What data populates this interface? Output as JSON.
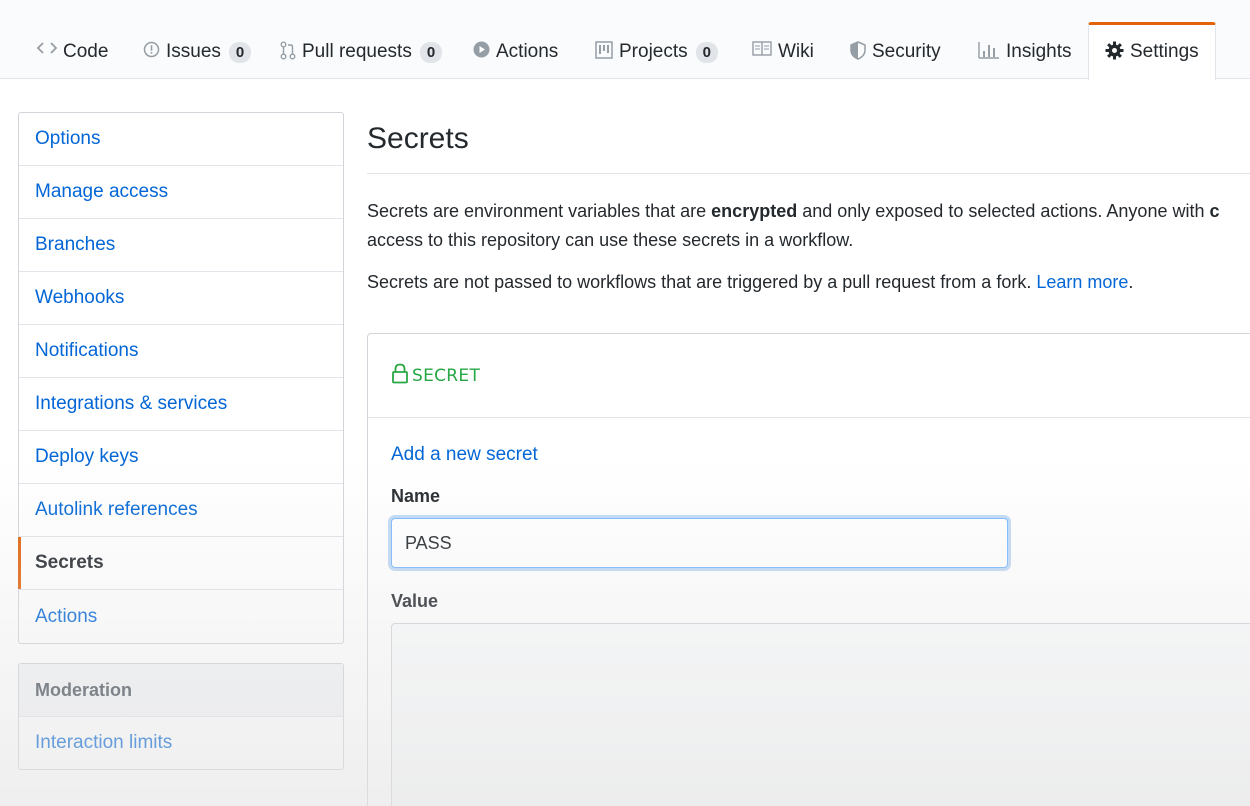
{
  "nav": {
    "tabs": [
      {
        "label": "Code",
        "icon": "code-icon"
      },
      {
        "label": "Issues",
        "count": "0",
        "icon": "issue-icon"
      },
      {
        "label": "Pull requests",
        "count": "0",
        "icon": "pull-request-icon"
      },
      {
        "label": "Actions",
        "icon": "play-icon"
      },
      {
        "label": "Projects",
        "count": "0",
        "icon": "project-icon"
      },
      {
        "label": "Wiki",
        "icon": "book-icon"
      },
      {
        "label": "Security",
        "icon": "shield-icon"
      },
      {
        "label": "Insights",
        "icon": "graph-icon"
      },
      {
        "label": "Settings",
        "icon": "gear-icon",
        "selected": true
      }
    ]
  },
  "sidebar": {
    "items": [
      {
        "label": "Options"
      },
      {
        "label": "Manage access"
      },
      {
        "label": "Branches"
      },
      {
        "label": "Webhooks"
      },
      {
        "label": "Notifications"
      },
      {
        "label": "Integrations & services"
      },
      {
        "label": "Deploy keys"
      },
      {
        "label": "Autolink references"
      },
      {
        "label": "Secrets",
        "selected": true
      },
      {
        "label": "Actions"
      }
    ],
    "moderation": {
      "heading": "Moderation",
      "items": [
        {
          "label": "Interaction limits"
        }
      ]
    }
  },
  "main": {
    "title": "Secrets",
    "desc_part1": "Secrets are environment variables that are ",
    "desc_bold": "encrypted",
    "desc_part2": " and only exposed to selected actions. Anyone with ",
    "desc_bold2": "c",
    "desc_line2": "access to this repository can use these secrets in a workflow.",
    "fork_text": "Secrets are not passed to workflows that are triggered by a pull request from a fork. ",
    "learn_more": "Learn more",
    "fork_period": ".",
    "box": {
      "badge": "SECRET",
      "add_link": "Add a new secret",
      "name_label": "Name",
      "name_value": "PASS",
      "value_label": "Value"
    }
  },
  "colors": {
    "accent": "#e36209",
    "link": "#0366d6",
    "success": "#28a745"
  }
}
